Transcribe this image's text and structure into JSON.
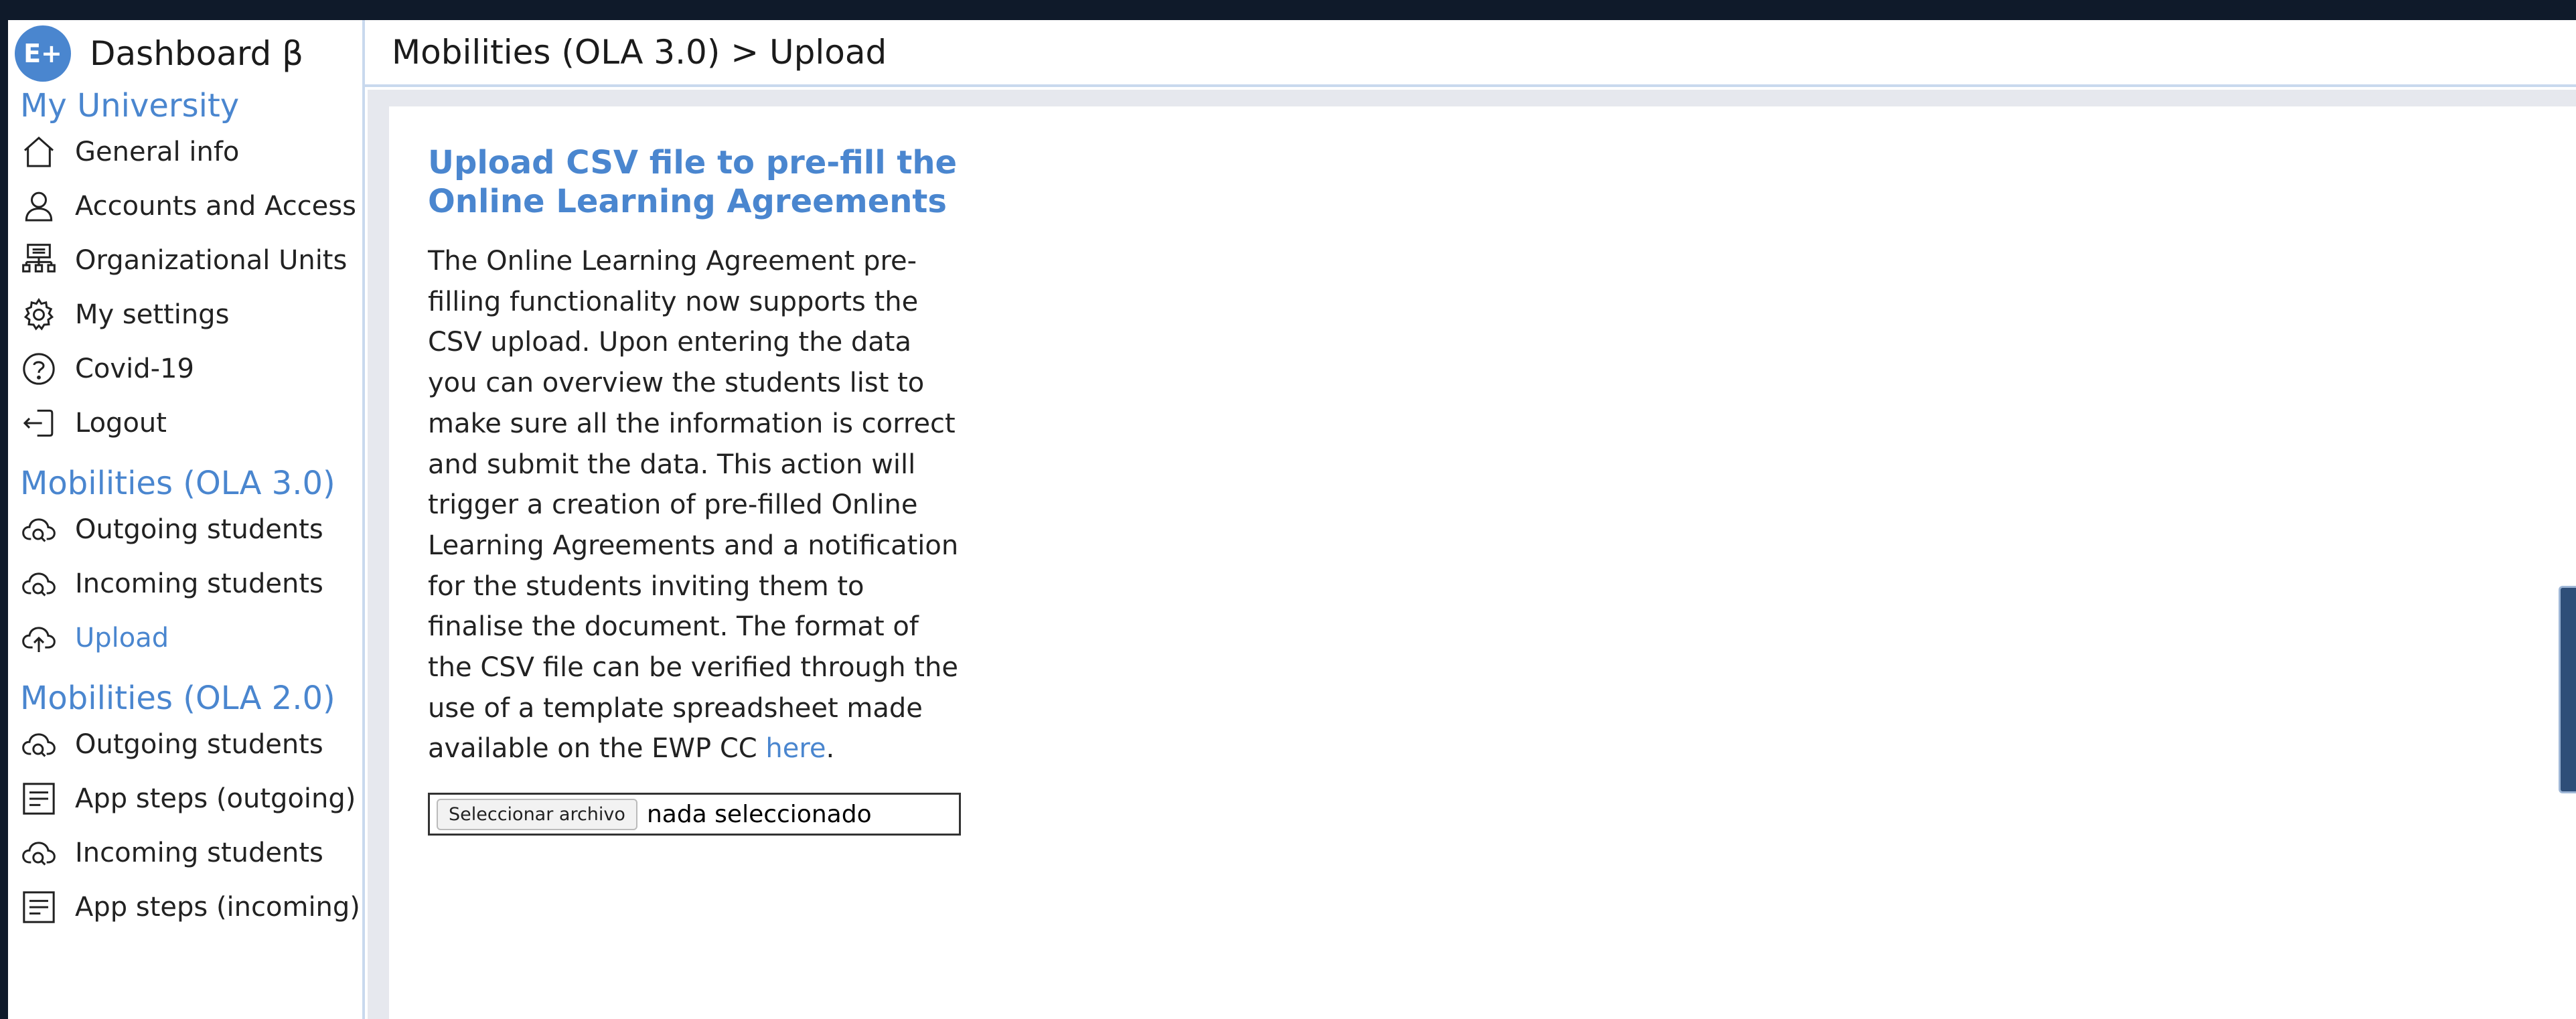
{
  "brand": {
    "logo_text": "E+",
    "title": "Dashboard β"
  },
  "header": {
    "breadcrumb": "Mobilities (OLA 3.0) > Upload"
  },
  "sidebar": {
    "sections": [
      {
        "title": "My University",
        "items": [
          {
            "label": "General info",
            "icon": "home-icon"
          },
          {
            "label": "Accounts and Access",
            "icon": "user-icon"
          },
          {
            "label": "Organizational Units",
            "icon": "org-chart-icon"
          },
          {
            "label": "My settings",
            "icon": "gear-icon"
          },
          {
            "label": "Covid-19",
            "icon": "question-circle-icon"
          },
          {
            "label": "Logout",
            "icon": "logout-icon"
          }
        ]
      },
      {
        "title": "Mobilities (OLA 3.0)",
        "items": [
          {
            "label": "Outgoing students",
            "icon": "cloud-search-icon"
          },
          {
            "label": "Incoming students",
            "icon": "cloud-search-icon"
          },
          {
            "label": "Upload",
            "icon": "cloud-upload-icon",
            "active": true
          }
        ]
      },
      {
        "title": "Mobilities (OLA 2.0)",
        "items": [
          {
            "label": "Outgoing students",
            "icon": "cloud-search-icon"
          },
          {
            "label": "App steps (outgoing)",
            "icon": "list-doc-icon"
          },
          {
            "label": "Incoming students",
            "icon": "cloud-search-icon"
          },
          {
            "label": "App steps (incoming)",
            "icon": "list-doc-icon"
          }
        ]
      }
    ]
  },
  "main": {
    "title": "Upload CSV file to pre-fill the Online Learning Agreements",
    "description": "The Online Learning Agreement pre-filling functionality now supports the CSV upload. Upon entering the data you can overview the students list to make sure all the information is correct and submit the data. This action will trigger a creation of pre-filled Online Learning Agreements and a notification for the students inviting them to finalise the document. The format of the CSV file can be verified through the use of a template spreadsheet made available on the EWP CC",
    "link_text": "here",
    "description_end": ".",
    "file_button": "Seleccionar archivo",
    "file_status": "nada seleccionado"
  },
  "colors": {
    "accent": "#4a86cf",
    "border": "#c9d9ee",
    "background": "#e6e8ee",
    "frame": "#0f1a2a"
  }
}
